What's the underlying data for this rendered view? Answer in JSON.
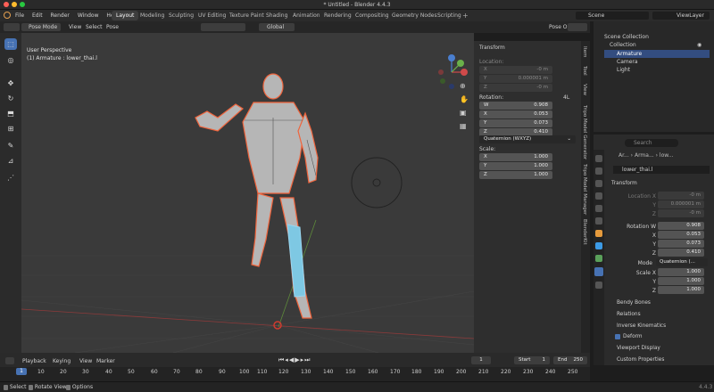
{
  "window_title": "* Untitled - Blender 4.4.3",
  "menus": [
    "File",
    "Edit",
    "Render",
    "Window",
    "Help"
  ],
  "workspaces": [
    "Layout",
    "Modeling",
    "Sculpting",
    "UV Editing",
    "Texture Paint",
    "Shading",
    "Animation",
    "Rendering",
    "Compositing",
    "Geometry Nodes",
    "Scripting"
  ],
  "active_workspace": "Layout",
  "scene": "Scene",
  "view_layer": "ViewLayer",
  "viewport_header": {
    "mode": "Pose Mode",
    "menus": [
      "View",
      "Select",
      "Pose"
    ],
    "orientation": "Global",
    "pose_options": "Pose Options"
  },
  "viewport": {
    "perspective": "User Perspective",
    "context": "(1) Armature : lower_thai.l",
    "axes": {
      "x": "X",
      "y": "Y",
      "z": "Z"
    }
  },
  "n_panel": {
    "title": "Transform",
    "location_label": "Location:",
    "location": [
      {
        "axis": "X",
        "value": "-0 m"
      },
      {
        "axis": "Y",
        "value": "0.000001 m"
      },
      {
        "axis": "Z",
        "value": "-0 m"
      }
    ],
    "rotation_label": "Rotation:",
    "rotation_mode_short": "4L",
    "rotation": [
      {
        "axis": "W",
        "value": "0.908"
      },
      {
        "axis": "X",
        "value": "0.053"
      },
      {
        "axis": "Y",
        "value": "0.073"
      },
      {
        "axis": "Z",
        "value": "0.410"
      }
    ],
    "rotation_mode": "Quaternion (WXYZ)",
    "scale_label": "Scale:",
    "scale": [
      {
        "axis": "X",
        "value": "1.000"
      },
      {
        "axis": "Y",
        "value": "1.000"
      },
      {
        "axis": "Z",
        "value": "1.000"
      }
    ],
    "tabs": [
      "Item",
      "Tool",
      "View",
      "Tripo Model Generator",
      "Tripo Model Manager",
      "BlenderKit"
    ]
  },
  "outliner": {
    "root": "Scene Collection",
    "collection": "Collection",
    "items": [
      "Armature",
      "Camera",
      "Light"
    ]
  },
  "properties": {
    "search_placeholder": "Search",
    "breadcrumb": [
      "Ar...",
      "Arma...",
      "low..."
    ],
    "bone_name": "lower_thai.l",
    "transform_title": "Transform",
    "location": [
      {
        "axis": "Location X",
        "value": "-0 m"
      },
      {
        "axis": "Y",
        "value": "0.000001 m"
      },
      {
        "axis": "Z",
        "value": "-0 m"
      }
    ],
    "rotation": [
      {
        "axis": "Rotation W",
        "value": "0.908"
      },
      {
        "axis": "X",
        "value": "0.053"
      },
      {
        "axis": "Y",
        "value": "0.073"
      },
      {
        "axis": "Z",
        "value": "0.410"
      }
    ],
    "mode_label": "Mode",
    "mode_value": "Quaternion (...",
    "scale": [
      {
        "axis": "Scale X",
        "value": "1.000"
      },
      {
        "axis": "Y",
        "value": "1.000"
      },
      {
        "axis": "Z",
        "value": "1.000"
      }
    ],
    "sections": [
      "Bendy Bones",
      "Relations",
      "Inverse Kinematics",
      "Deform",
      "Viewport Display",
      "Custom Properties"
    ]
  },
  "timeline": {
    "menus": [
      "Playback",
      "Keying",
      "View",
      "Marker"
    ],
    "current_frame": "1",
    "start_label": "Start",
    "start": "1",
    "end_label": "End",
    "end": "250",
    "ticks": [
      "1",
      "10",
      "20",
      "30",
      "40",
      "50",
      "60",
      "70",
      "80",
      "90",
      "100",
      "110",
      "120",
      "130",
      "140",
      "150",
      "160",
      "170",
      "180",
      "190",
      "200",
      "210",
      "220",
      "230",
      "240",
      "250"
    ]
  },
  "status": {
    "items": [
      "Select",
      "Rotate View",
      "Options"
    ],
    "version": "4.4.3"
  },
  "colors": {
    "accent": "#4772b3",
    "selection": "#f0643c",
    "bone_active": "#7ec8e3"
  }
}
